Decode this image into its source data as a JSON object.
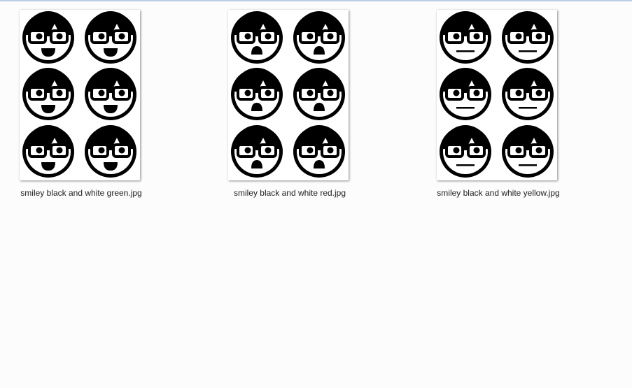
{
  "window": {
    "accent_color": "#b9cfe6",
    "background_color": "#fcfcfc"
  },
  "files": [
    {
      "name": "smiley black and white green.jpg",
      "thumbnail_icon": "smiley-happy-icon",
      "expression": "happy"
    },
    {
      "name": "smiley black and white red.jpg",
      "thumbnail_icon": "smiley-sad-icon",
      "expression": "sad"
    },
    {
      "name": "smiley black and white yellow.jpg",
      "thumbnail_icon": "smiley-neutral-icon",
      "expression": "neutral"
    }
  ]
}
